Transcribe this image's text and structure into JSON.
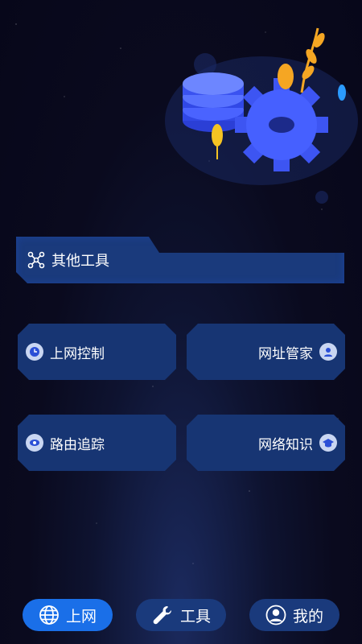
{
  "header": {
    "label": "其他工具",
    "icon": "network-nodes-icon"
  },
  "tiles": [
    {
      "label": "上网控制",
      "icon": "clock-icon"
    },
    {
      "label": "网址管家",
      "icon": "user-badge-icon"
    },
    {
      "label": "路由追踪",
      "icon": "eye-icon"
    },
    {
      "label": "网络知识",
      "icon": "graduation-cap-icon"
    }
  ],
  "nav": [
    {
      "label": "上网",
      "icon": "globe-icon",
      "active": true
    },
    {
      "label": "工具",
      "icon": "wrench-icon",
      "active": true
    },
    {
      "label": "我的",
      "icon": "user-icon",
      "active": false
    }
  ],
  "colors": {
    "accent": "#1a6fe8",
    "panel": "#173573",
    "bg": "#0a0a1e"
  }
}
